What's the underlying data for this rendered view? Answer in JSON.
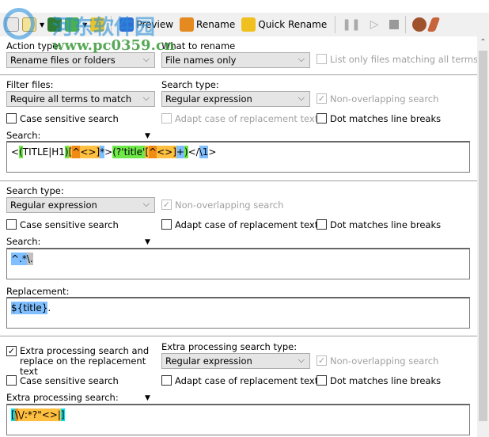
{
  "watermark": {
    "title": "河东软件园",
    "url": "www.pc0359.cn"
  },
  "toolbar": {
    "preview": "Preview",
    "rename": "Rename",
    "quick_rename": "Quick Rename"
  },
  "action": {
    "label": "Action type:",
    "value": "Rename files or folders"
  },
  "what": {
    "label": "What to rename",
    "value": "File names only"
  },
  "list_only": "List only files matching all terms",
  "filter": {
    "label": "Filter files:",
    "value": "Require all terms to match"
  },
  "search_type_label": "Search type:",
  "search_type_value": "Regular expression",
  "non_overlapping": "Non-overlapping search",
  "case_sensitive": "Case sensitive search",
  "adapt_case": "Adapt case of replacement text",
  "dot_matches": "Dot matches line breaks",
  "search_label": "Search:",
  "search1": [
    [
      "<",
      ""
    ],
    [
      "(",
      "g"
    ],
    [
      "TITLE|H1",
      ""
    ],
    [
      ")",
      "g"
    ],
    [
      "[",
      "o"
    ],
    [
      "^",
      "do"
    ],
    [
      "<>",
      "o"
    ],
    [
      "]",
      "o"
    ],
    [
      "*",
      "b"
    ],
    [
      ">",
      ""
    ],
    [
      "(?'title'",
      "g"
    ],
    [
      "[",
      "o"
    ],
    [
      "^",
      "do"
    ],
    [
      "<>",
      "o"
    ],
    [
      "]",
      "o"
    ],
    [
      "+",
      "b"
    ],
    [
      ")",
      "g"
    ],
    [
      "</",
      ""
    ],
    [
      "\\1",
      "b"
    ],
    [
      ">",
      ""
    ]
  ],
  "search2": [
    [
      "^.*",
      "b"
    ],
    [
      "\\.",
      "gr"
    ]
  ],
  "replacement_label": "Replacement:",
  "replacement": [
    [
      "${title}",
      "b"
    ],
    [
      ".",
      ""
    ]
  ],
  "extra": {
    "checkbox": "Extra processing search and replace on the replacement text",
    "type_label": "Extra processing search type:",
    "search_label": "Extra processing search:"
  },
  "search3": [
    [
      "[",
      "c"
    ],
    [
      "\\",
      "do"
    ],
    [
      "\\/:*?\"<>|",
      "o"
    ],
    [
      "]",
      "c"
    ]
  ]
}
